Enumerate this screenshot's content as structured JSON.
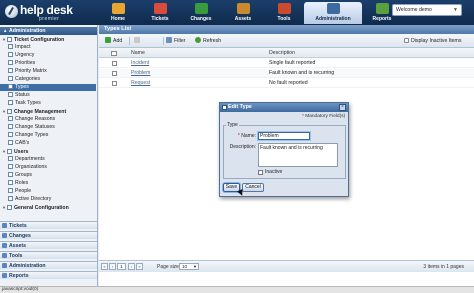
{
  "app": {
    "logo_text": "help desk",
    "logo_sub": "premier"
  },
  "nav": {
    "tabs": [
      {
        "label": "Home",
        "icon": "home-icon",
        "color": "#e8a530"
      },
      {
        "label": "Tickets",
        "icon": "tickets-icon",
        "color": "#d94b3a"
      },
      {
        "label": "Changes",
        "icon": "changes-icon",
        "color": "#3a9a3e"
      },
      {
        "label": "Assets",
        "icon": "assets-icon",
        "color": "#c9892f"
      },
      {
        "label": "Tools",
        "icon": "tools-icon",
        "color": "#cc4a2e"
      },
      {
        "label": "Administration",
        "icon": "administration-icon",
        "color": "#3d6aa0"
      },
      {
        "label": "Reports",
        "icon": "reports-icon",
        "color": "#5aa03c"
      }
    ],
    "active_tab": "Administration",
    "user_menu": "Welcome demo"
  },
  "sidebar": {
    "header": "Administration",
    "items": [
      {
        "label": "Ticket Configuration",
        "kind": "group"
      },
      {
        "label": "Impact"
      },
      {
        "label": "Urgency"
      },
      {
        "label": "Priorities"
      },
      {
        "label": "Priority Matrix"
      },
      {
        "label": "Categories"
      },
      {
        "label": "Types",
        "selected": true
      },
      {
        "label": "Status"
      },
      {
        "label": "Task Types"
      },
      {
        "label": "Change Management",
        "kind": "group"
      },
      {
        "label": "Change Reasons"
      },
      {
        "label": "Change Statuses"
      },
      {
        "label": "Change Types"
      },
      {
        "label": "CAB's"
      },
      {
        "label": "Users",
        "kind": "group"
      },
      {
        "label": "Departments"
      },
      {
        "label": "Organizations"
      },
      {
        "label": "Groups"
      },
      {
        "label": "Roles"
      },
      {
        "label": "People"
      },
      {
        "label": "Active Directory"
      },
      {
        "label": "General Configuration",
        "kind": "group"
      }
    ],
    "footer_sections": [
      "Tickets",
      "Changes",
      "Assets",
      "Tools",
      "Administration",
      "Reports"
    ]
  },
  "main": {
    "title": "Types List",
    "toolbar": {
      "add": "Add",
      "filter": "Filter",
      "refresh": "Refresh",
      "display_inactive": "Display Inactive Items"
    },
    "columns": {
      "name": "Name",
      "description": "Description"
    },
    "rows": [
      {
        "name": "Incident",
        "description": "Single fault reported"
      },
      {
        "name": "Problem",
        "description": "Fault known and is recurring"
      },
      {
        "name": "Request",
        "description": "No fault reported"
      }
    ],
    "pager": {
      "page": "1",
      "page_size_label": "Page size:",
      "page_size": "10",
      "status": "3 items in 1 pages"
    }
  },
  "dialog": {
    "title": "Edit Type",
    "mandatory_note": "Mandatory Field(s)",
    "fieldset_legend": "Type",
    "name_label": "Name:",
    "name_value": "Problem",
    "description_label": "Description:",
    "description_value": "Fault known and is recurring",
    "inactive_label": "Inactive",
    "save": "Save",
    "cancel": "Cancel"
  },
  "statusbar": "javascript:void(0)"
}
